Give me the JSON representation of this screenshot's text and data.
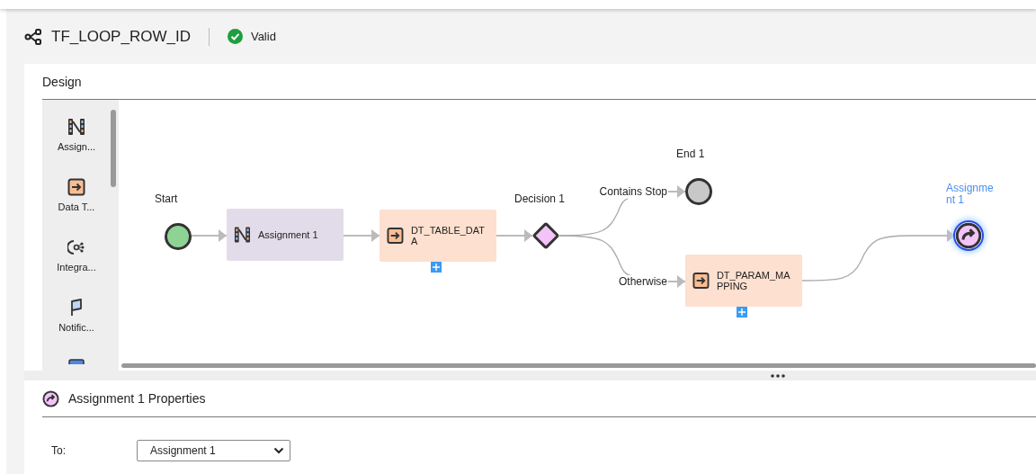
{
  "header": {
    "title": "TF_LOOP_ROW_ID",
    "status": "Valid"
  },
  "design": {
    "title": "Design",
    "palette": [
      {
        "kind": "assignment",
        "label": "Assign..."
      },
      {
        "kind": "data-task",
        "label": "Data T..."
      },
      {
        "kind": "integration",
        "label": "Integra..."
      },
      {
        "kind": "notification",
        "label": "Notific..."
      },
      {
        "kind": "other"
      }
    ],
    "nodes": [
      {
        "kind": "start",
        "label": "Start",
        "selected": false
      },
      {
        "kind": "assignment",
        "label": "Assignment 1",
        "selected": false
      },
      {
        "kind": "data-task",
        "label": "DT_TABLE_DATA",
        "selected": false
      },
      {
        "kind": "decision",
        "label": "Decision 1",
        "selected": false
      },
      {
        "kind": "end",
        "label": "End 1",
        "selected": false
      },
      {
        "kind": "data-task",
        "label": "DT_PARAM_MAPPING",
        "selected": false
      },
      {
        "kind": "jump",
        "label": "Assignment 1",
        "selected": true
      }
    ],
    "edge_labels": [
      "Contains Stop",
      "Otherwise"
    ]
  },
  "properties": {
    "title": "Assignment 1 Properties",
    "field_label": "To:",
    "value": "Assignment 1"
  }
}
